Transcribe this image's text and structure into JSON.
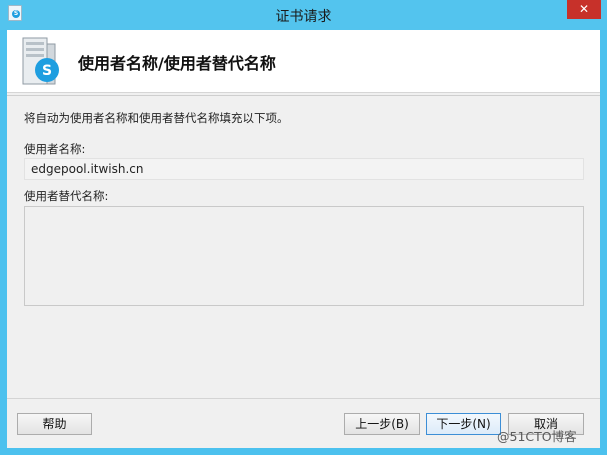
{
  "window": {
    "title": "证书请求",
    "close_symbol": "✕"
  },
  "header": {
    "title": "使用者名称/使用者替代名称",
    "icon": "server-skype-icon"
  },
  "content": {
    "description": "将自动为使用者名称和使用者替代名称填充以下项。",
    "subject_label": "使用者名称:",
    "subject_value": "edgepool.itwish.cn",
    "san_label": "使用者替代名称:",
    "san_value": ""
  },
  "buttons": {
    "help": "帮助",
    "back": "上一步(B)",
    "next": "下一步(N)",
    "cancel": "取消"
  },
  "watermark": "@51CTO博客",
  "colors": {
    "titlebar": "#53c4ee",
    "close_button": "#c7312a",
    "client_bg": "#f0f0f0"
  }
}
